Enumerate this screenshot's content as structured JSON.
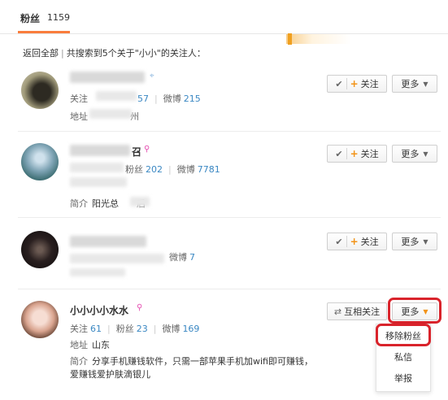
{
  "tabs": {
    "active_label": "粉丝",
    "active_count": "1159"
  },
  "search": {
    "back_label": "返回全部",
    "sep": "|",
    "result_text": "共搜索到5个关于\"小小\"的关注人："
  },
  "users": [
    {
      "stats": [
        {
          "label": "关注",
          "value": "57"
        },
        {
          "label": "微博",
          "value": "215"
        }
      ],
      "address_label": "地址",
      "address_value": "州",
      "follow_label": "关注",
      "more_label": "更多"
    },
    {
      "stats": [
        {
          "label": "粉丝",
          "value": "202"
        },
        {
          "label": "微博",
          "value": "7781"
        }
      ],
      "bio_label": "简介",
      "bio_value": "阳光总",
      "bio_tail": "后",
      "follow_label": "关注",
      "more_label": "更多"
    },
    {
      "stats": [
        {
          "label": "微博",
          "value": "7"
        }
      ],
      "follow_label": "关注",
      "more_label": "更多"
    },
    {
      "name": "小小小小水水",
      "stats": [
        {
          "label": "关注",
          "value": "61"
        },
        {
          "label": "粉丝",
          "value": "23"
        },
        {
          "label": "微博",
          "value": "169"
        }
      ],
      "address_label": "地址",
      "address_value": "山东",
      "bio_label": "简介",
      "bio_value": "分享手机赚钱软件，只需一部苹果手机加wifi即可赚钱，",
      "bio_line2": "爱赚钱爱护肤滴银儿",
      "mutual_label": "互相关注",
      "more_label": "更多"
    }
  ],
  "dropdown": {
    "items": [
      "移除粉丝",
      "私信",
      "举报"
    ]
  },
  "colors": {
    "accent": "#fa7d3c",
    "link": "#3b88c3",
    "highlight": "#d9232b",
    "member": "#e54eb1"
  }
}
